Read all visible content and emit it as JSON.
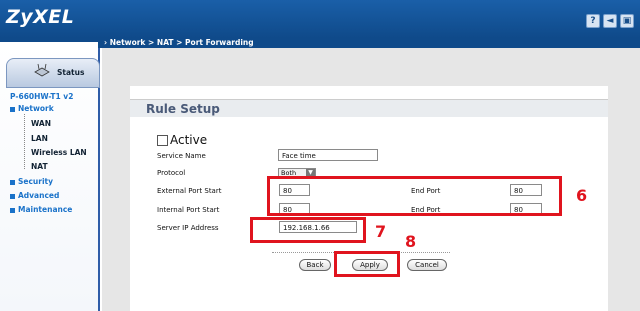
{
  "brand": {
    "logo": "ZyXEL"
  },
  "header": {
    "help_icon": "?",
    "back_icon": "◄"
  },
  "breadcrumb": "Network > NAT > Port Forwarding",
  "sidebar": {
    "status_label": "Status",
    "device": "P-660HW-T1 v2",
    "menu": [
      {
        "label": "Network"
      },
      {
        "label": "Security"
      },
      {
        "label": "Advanced"
      },
      {
        "label": "Maintenance"
      }
    ],
    "network_sub": [
      "WAN",
      "LAN",
      "Wireless LAN",
      "NAT"
    ]
  },
  "form": {
    "title": "Rule Setup",
    "active_label": "Active",
    "service_name_label": "Service Name",
    "service_name_value": "Face time",
    "protocol_label": "Protocol",
    "protocol_value": "Both",
    "ext_start_label": "External Port Start",
    "ext_start_value": "80",
    "ext_end_label": "End Port",
    "ext_end_value": "80",
    "int_start_label": "Internal Port Start",
    "int_start_value": "80",
    "int_end_label": "End Port",
    "int_end_value": "80",
    "server_ip_label": "Server IP Address",
    "server_ip_value": "192.168.1.66",
    "back": "Back",
    "apply": "Apply",
    "cancel": "Cancel"
  },
  "annotations": {
    "n6": "6",
    "n7": "7",
    "n8": "8",
    "color": "#e0141e"
  }
}
